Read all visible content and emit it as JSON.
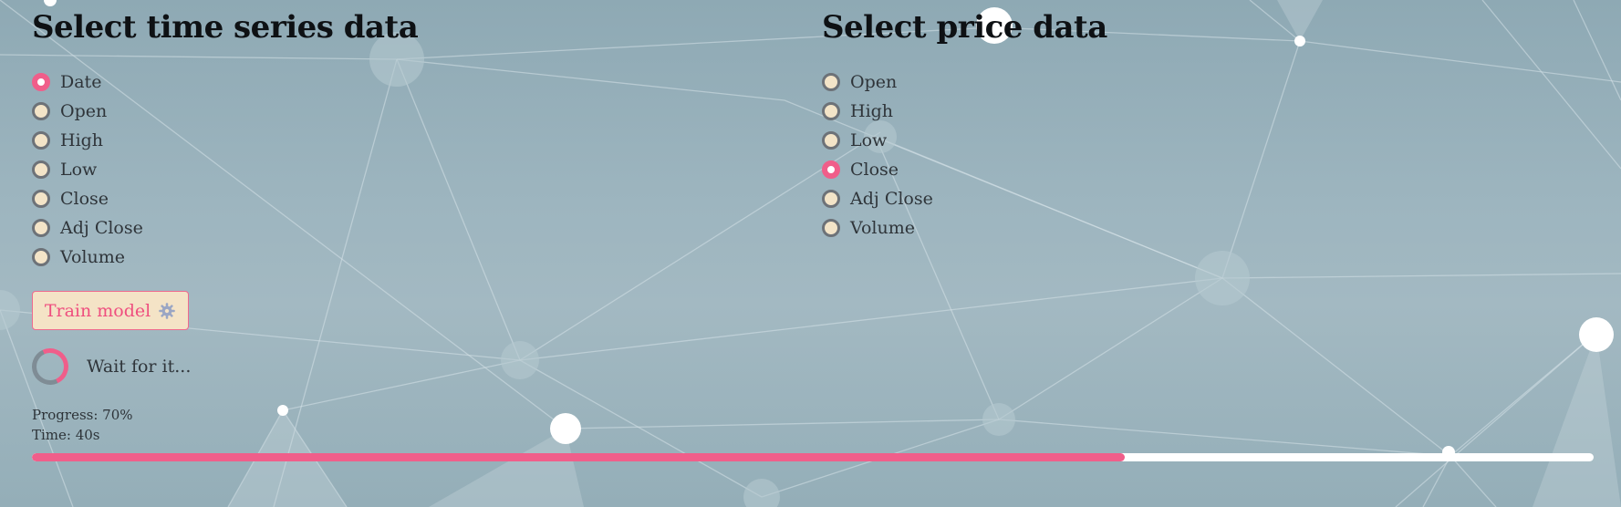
{
  "time_series": {
    "title": "Select time series data",
    "options": [
      "Date",
      "Open",
      "High",
      "Low",
      "Close",
      "Adj Close",
      "Volume"
    ],
    "selected": "Date"
  },
  "price": {
    "title": "Select price data",
    "options": [
      "Open",
      "High",
      "Low",
      "Close",
      "Adj Close",
      "Volume"
    ],
    "selected": "Close"
  },
  "train_button": {
    "label": "Train model",
    "icon": "gear-icon"
  },
  "status": {
    "spinner_text": "Wait for it..."
  },
  "progress": {
    "label": "Progress: 70%",
    "time": "Time: 40s",
    "fraction": 0.7
  },
  "colors": {
    "accent": "#f05e8a",
    "radio_fill": "#f3e4c8",
    "button_bg": "#f4e3c6"
  }
}
